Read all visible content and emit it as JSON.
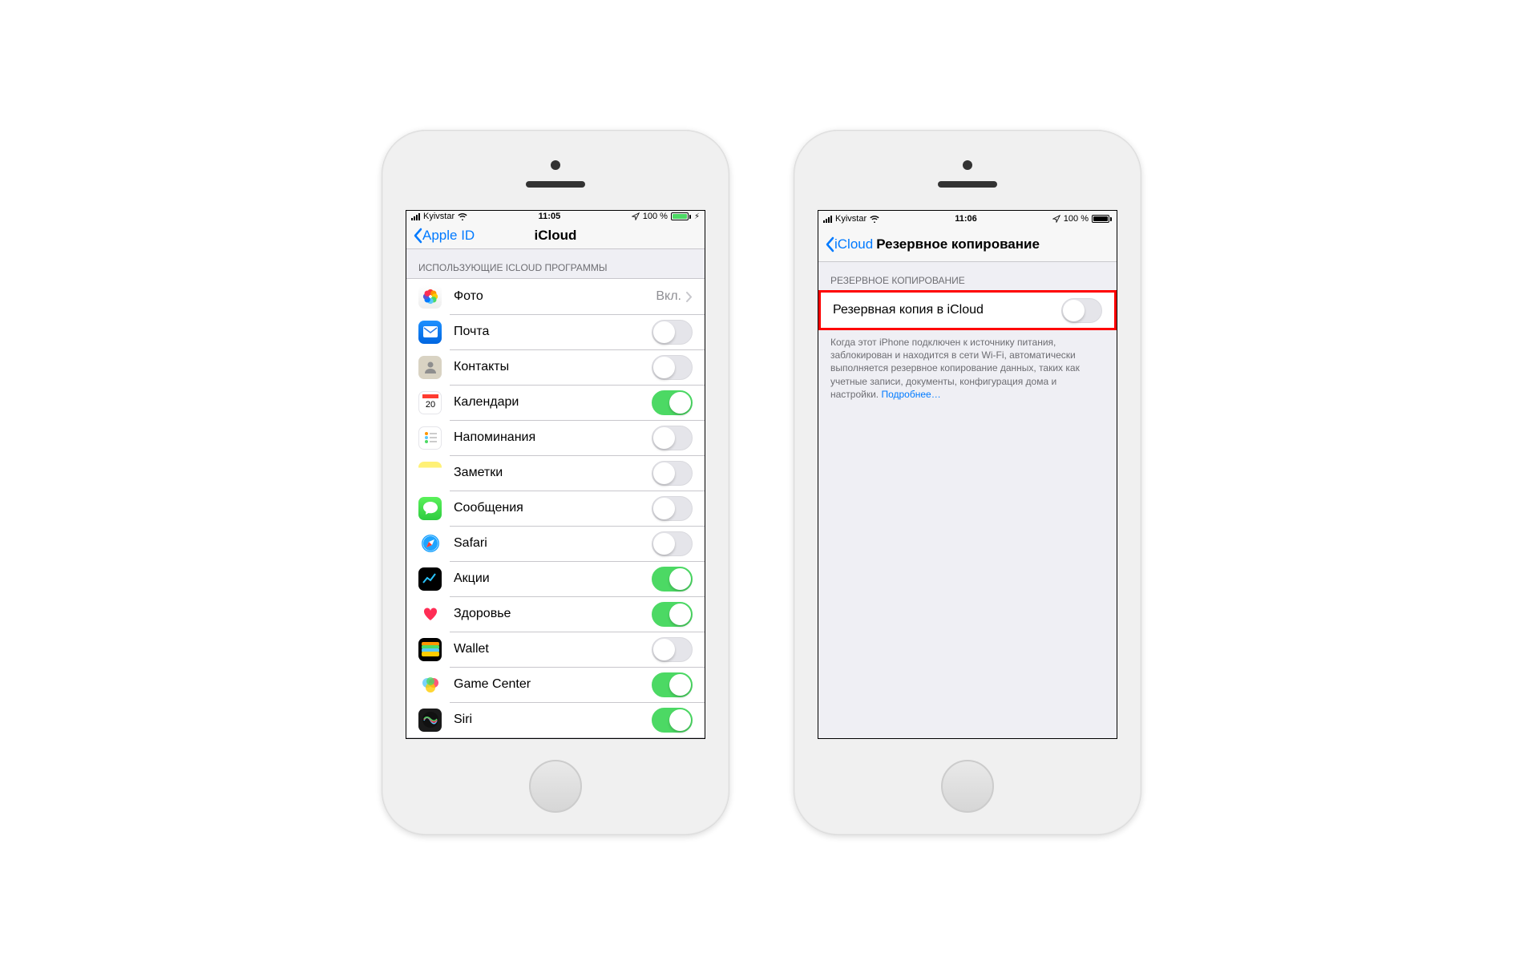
{
  "phone1": {
    "status": {
      "carrier": "Kyivstar",
      "time": "11:05",
      "battery_pct": "100 %",
      "charging": true,
      "battery_style": "green"
    },
    "nav": {
      "back": "Apple ID",
      "title": "iCloud"
    },
    "section_header": "ИСПОЛЬЗУЮЩИЕ ICLOUD ПРОГРАММЫ",
    "rows": [
      {
        "name": "photos",
        "label": "Фото",
        "detail": "Вкл.",
        "disclosure": true
      },
      {
        "name": "mail",
        "label": "Почта",
        "toggle": false
      },
      {
        "name": "contacts",
        "label": "Контакты",
        "toggle": false
      },
      {
        "name": "calendar",
        "label": "Календари",
        "toggle": true
      },
      {
        "name": "reminders",
        "label": "Напоминания",
        "toggle": false
      },
      {
        "name": "notes",
        "label": "Заметки",
        "toggle": false
      },
      {
        "name": "messages",
        "label": "Сообщения",
        "toggle": false
      },
      {
        "name": "safari",
        "label": "Safari",
        "toggle": false
      },
      {
        "name": "stocks",
        "label": "Акции",
        "toggle": true
      },
      {
        "name": "health",
        "label": "Здоровье",
        "toggle": true
      },
      {
        "name": "wallet",
        "label": "Wallet",
        "toggle": false
      },
      {
        "name": "gamecenter",
        "label": "Game Center",
        "toggle": true
      },
      {
        "name": "siri",
        "label": "Siri",
        "toggle": true
      }
    ]
  },
  "phone2": {
    "status": {
      "carrier": "Kyivstar",
      "time": "11:06",
      "battery_pct": "100 %",
      "charging": false,
      "battery_style": "black"
    },
    "nav": {
      "back": "iCloud",
      "title": "Резервное копирование"
    },
    "section_header": "РЕЗЕРВНОЕ КОПИРОВАНИЕ",
    "backup_row": {
      "label": "Резервная копия в iCloud",
      "toggle": false
    },
    "footer_text": "Когда этот iPhone подключен к источнику питания, заблокирован и находится в сети Wi-Fi, автоматически выполняется резервное копирование данных, таких как учетные записи, документы, конфигурация дома и настройки. ",
    "footer_link": "Подробнее…"
  },
  "icon_map": {
    "photos": "ic-photos",
    "mail": "ic-mail",
    "contacts": "ic-contacts",
    "calendar": "ic-calendar",
    "reminders": "ic-reminders",
    "notes": "ic-notes",
    "messages": "ic-messages",
    "safari": "ic-safari",
    "stocks": "ic-stocks",
    "health": "ic-health",
    "wallet": "ic-wallet",
    "gamecenter": "ic-gamecenter",
    "siri": "ic-siri"
  }
}
